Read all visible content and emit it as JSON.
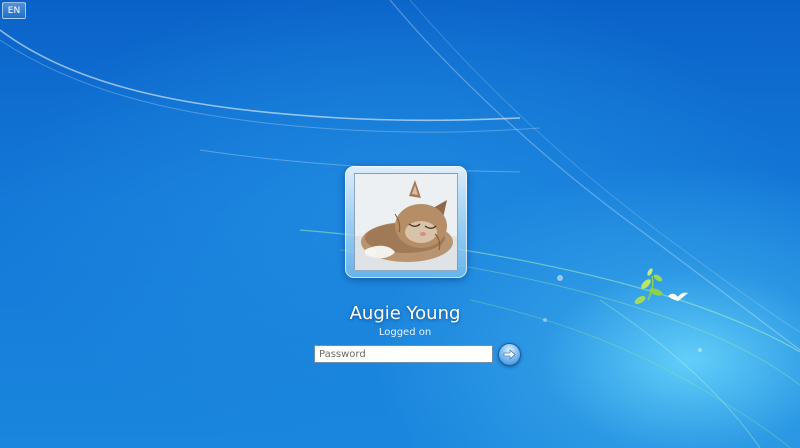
{
  "language_indicator": {
    "label": "EN"
  },
  "user": {
    "name": "Augie Young",
    "status": "Logged on",
    "avatar_icon": "kitten-photo"
  },
  "password": {
    "placeholder": "Password",
    "value": ""
  },
  "submit": {
    "icon": "arrow-right-icon"
  },
  "colors": {
    "background_top": "#0a62c8",
    "background_glow": "#6edcff",
    "accent_leaf": "#8fd24a"
  }
}
